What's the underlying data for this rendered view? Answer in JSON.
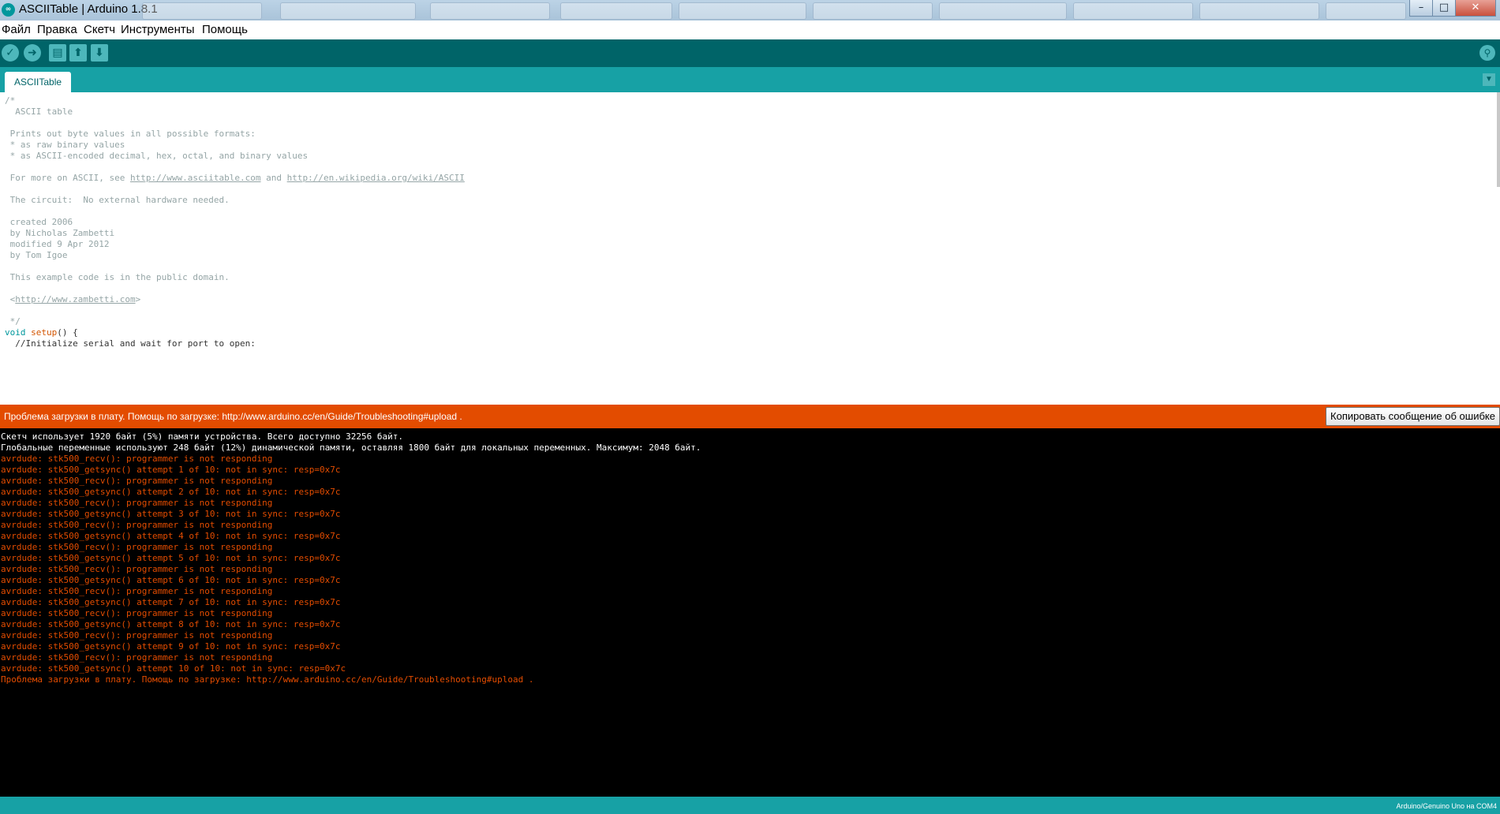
{
  "window": {
    "title": "ASCIITable | Arduino 1.8.1",
    "logo_text": "∞",
    "minimize": "–",
    "maximize": "□",
    "close": "✕"
  },
  "menu": [
    "Файл",
    "Правка",
    "Скетч",
    "Инструменты",
    "Помощь"
  ],
  "toolbar": {
    "verify_icon": "checkmark-icon",
    "upload_icon": "arrow-right-icon",
    "new_icon": "new-file-icon",
    "open_icon": "arrow-up-icon",
    "save_icon": "arrow-down-icon",
    "serial_monitor_icon": "magnifier-icon"
  },
  "tabs": {
    "active": "ASCIITable",
    "menu_icon": "▼"
  },
  "editor": {
    "lines": [
      "/*",
      "  ASCII table",
      "",
      " Prints out byte values in all possible formats:",
      " * as raw binary values",
      " * as ASCII-encoded decimal, hex, octal, and binary values",
      "",
      "",
      "",
      " The circuit:  No external hardware needed.",
      "",
      " created 2006",
      " by Nicholas Zambetti",
      " modified 9 Apr 2012",
      " by Tom Igoe",
      "",
      " This example code is in the public domain.",
      "",
      "",
      "",
      " */",
      "",
      "  //Initialize serial and wait for port to open:"
    ],
    "more_line": {
      "prefix": " For more on ASCII, see ",
      "link1": "http://www.asciitable.com",
      "middle": " and ",
      "link2": "http://en.wikipedia.org/wiki/ASCII"
    },
    "url_line": {
      "open": " <",
      "link": "http://www.zambetti.com",
      "close": ">"
    },
    "setup_line": {
      "keyword": "void",
      "space": " ",
      "function": "setup",
      "rest": "() {"
    }
  },
  "error_bar": {
    "message": "Проблема загрузки в плату. Помощь по загрузке: http://www.arduino.cc/en/Guide/Troubleshooting#upload .",
    "copy_button": "Копировать сообщение об ошибке"
  },
  "console": {
    "lines": [
      {
        "text": "Скетч использует 1920 байт (5%) памяти устройства. Всего доступно 32256 байт.",
        "type": "info"
      },
      {
        "text": "Глобальные переменные используют 248 байт (12%) динамической памяти, оставляя 1800 байт для локальных переменных. Максимум: 2048 байт.",
        "type": "info"
      },
      {
        "text": "avrdude: stk500_recv(): programmer is not responding",
        "type": "err"
      },
      {
        "text": "avrdude: stk500_getsync() attempt 1 of 10: not in sync: resp=0x7c",
        "type": "err"
      },
      {
        "text": "avrdude: stk500_recv(): programmer is not responding",
        "type": "err"
      },
      {
        "text": "avrdude: stk500_getsync() attempt 2 of 10: not in sync: resp=0x7c",
        "type": "err"
      },
      {
        "text": "avrdude: stk500_recv(): programmer is not responding",
        "type": "err"
      },
      {
        "text": "avrdude: stk500_getsync() attempt 3 of 10: not in sync: resp=0x7c",
        "type": "err"
      },
      {
        "text": "avrdude: stk500_recv(): programmer is not responding",
        "type": "err"
      },
      {
        "text": "avrdude: stk500_getsync() attempt 4 of 10: not in sync: resp=0x7c",
        "type": "err"
      },
      {
        "text": "avrdude: stk500_recv(): programmer is not responding",
        "type": "err"
      },
      {
        "text": "avrdude: stk500_getsync() attempt 5 of 10: not in sync: resp=0x7c",
        "type": "err"
      },
      {
        "text": "avrdude: stk500_recv(): programmer is not responding",
        "type": "err"
      },
      {
        "text": "avrdude: stk500_getsync() attempt 6 of 10: not in sync: resp=0x7c",
        "type": "err"
      },
      {
        "text": "avrdude: stk500_recv(): programmer is not responding",
        "type": "err"
      },
      {
        "text": "avrdude: stk500_getsync() attempt 7 of 10: not in sync: resp=0x7c",
        "type": "err"
      },
      {
        "text": "avrdude: stk500_recv(): programmer is not responding",
        "type": "err"
      },
      {
        "text": "avrdude: stk500_getsync() attempt 8 of 10: not in sync: resp=0x7c",
        "type": "err"
      },
      {
        "text": "avrdude: stk500_recv(): programmer is not responding",
        "type": "err"
      },
      {
        "text": "avrdude: stk500_getsync() attempt 9 of 10: not in sync: resp=0x7c",
        "type": "err"
      },
      {
        "text": "avrdude: stk500_recv(): programmer is not responding",
        "type": "err"
      },
      {
        "text": "avrdude: stk500_getsync() attempt 10 of 10: not in sync: resp=0x7c",
        "type": "err"
      },
      {
        "text": "Проблема загрузки в плату. Помощь по загрузке: http://www.arduino.cc/en/Guide/Troubleshooting#upload .",
        "type": "err"
      }
    ]
  },
  "status_bar": {
    "board_port": "Arduino/Genuino Uno на COM4"
  },
  "colors": {
    "toolbar": "#006468",
    "tabbar": "#17a1a5",
    "error": "#e34c00",
    "console_bg": "#000000"
  }
}
